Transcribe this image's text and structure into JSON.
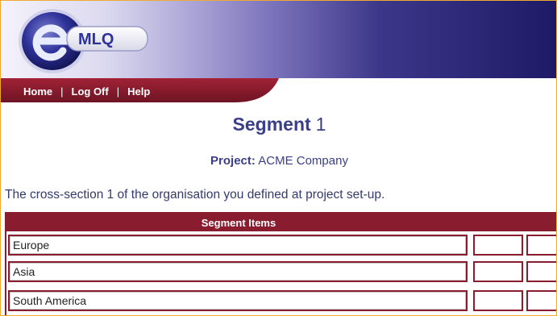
{
  "brand": {
    "logo_text": "MLQ",
    "logo_initial": "e"
  },
  "nav": {
    "items": [
      "Home",
      "Log Off",
      "Help"
    ],
    "separator": "|"
  },
  "page": {
    "title_bold": "Segment",
    "title_number": "1",
    "project_label": "Project:",
    "project_name": "ACME Company",
    "description": "The cross-section 1 of the organisation you defined at project set-up."
  },
  "table": {
    "header": "Segment Items",
    "rows": [
      "Europe",
      "Asia",
      "South America"
    ]
  },
  "colors": {
    "maroon": "#8a1c2f",
    "title_blue": "#3a3f86",
    "border_orange": "#f0a830"
  }
}
